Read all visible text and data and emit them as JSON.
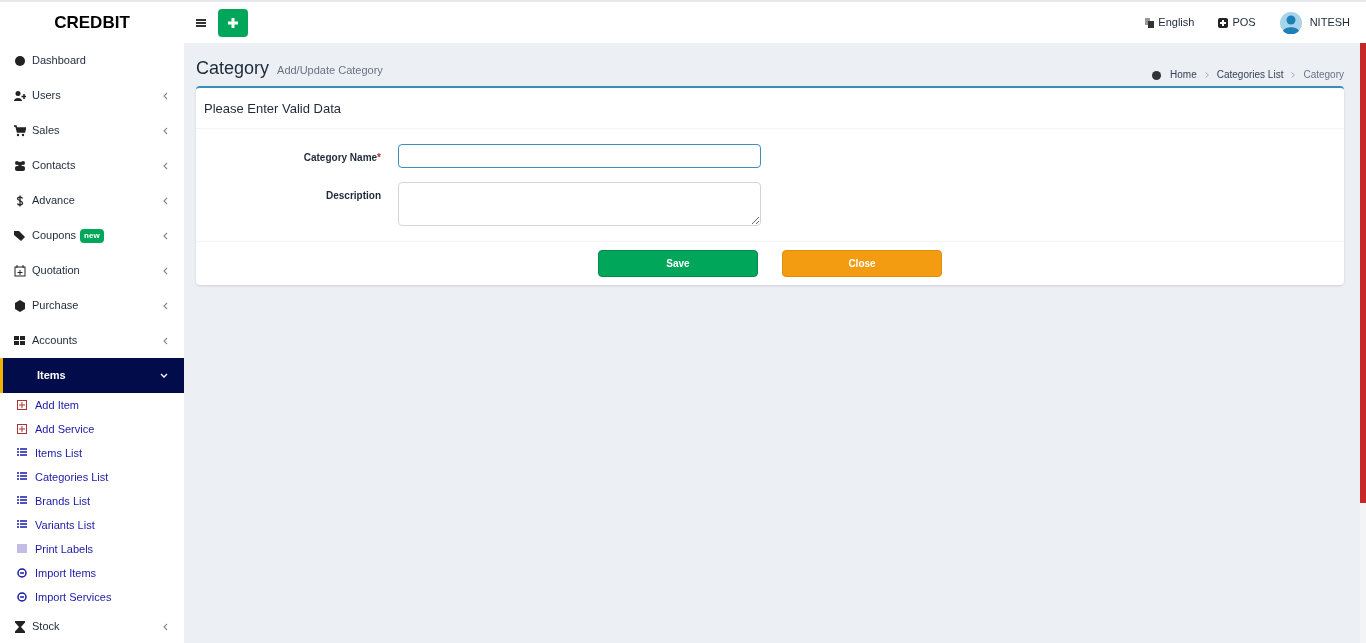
{
  "brand": "CREDBIT",
  "header": {
    "language": "English",
    "pos": "POS",
    "user": "NITESH"
  },
  "sidebar": {
    "items": [
      {
        "label": "Dashboard",
        "has_chevron": false,
        "expanded": false
      },
      {
        "label": "Users",
        "has_chevron": true,
        "expanded": false
      },
      {
        "label": "Sales",
        "has_chevron": true,
        "expanded": false
      },
      {
        "label": "Contacts",
        "has_chevron": true,
        "expanded": false
      },
      {
        "label": "Advance",
        "has_chevron": true,
        "expanded": false
      },
      {
        "label": "Coupons",
        "badge": "new",
        "has_chevron": true,
        "expanded": false
      },
      {
        "label": "Quotation",
        "has_chevron": true,
        "expanded": false
      },
      {
        "label": "Purchase",
        "has_chevron": true,
        "expanded": false
      },
      {
        "label": "Accounts",
        "has_chevron": true,
        "expanded": false
      },
      {
        "label": "Items",
        "has_chevron": true,
        "expanded": true,
        "children": [
          {
            "label": "Add Item"
          },
          {
            "label": "Add Service"
          },
          {
            "label": "Items List"
          },
          {
            "label": "Categories List"
          },
          {
            "label": "Brands List"
          },
          {
            "label": "Variants List"
          },
          {
            "label": "Print Labels"
          },
          {
            "label": "Import Items"
          },
          {
            "label": "Import Services"
          }
        ]
      },
      {
        "label": "Stock",
        "has_chevron": true,
        "expanded": false
      }
    ]
  },
  "page": {
    "title": "Category",
    "subtitle": "Add/Update Category",
    "breadcrumb": [
      "Home",
      "Categories List",
      "Category"
    ]
  },
  "form": {
    "heading": "Please Enter Valid Data",
    "fields": [
      {
        "label": "Category Name",
        "required_mark": "*",
        "kind": "input",
        "focused": true
      },
      {
        "label": "Description",
        "kind": "textarea",
        "focused": false
      }
    ],
    "buttons": [
      {
        "label": "Save",
        "kind": "save"
      },
      {
        "label": "Close",
        "kind": "close"
      }
    ]
  }
}
